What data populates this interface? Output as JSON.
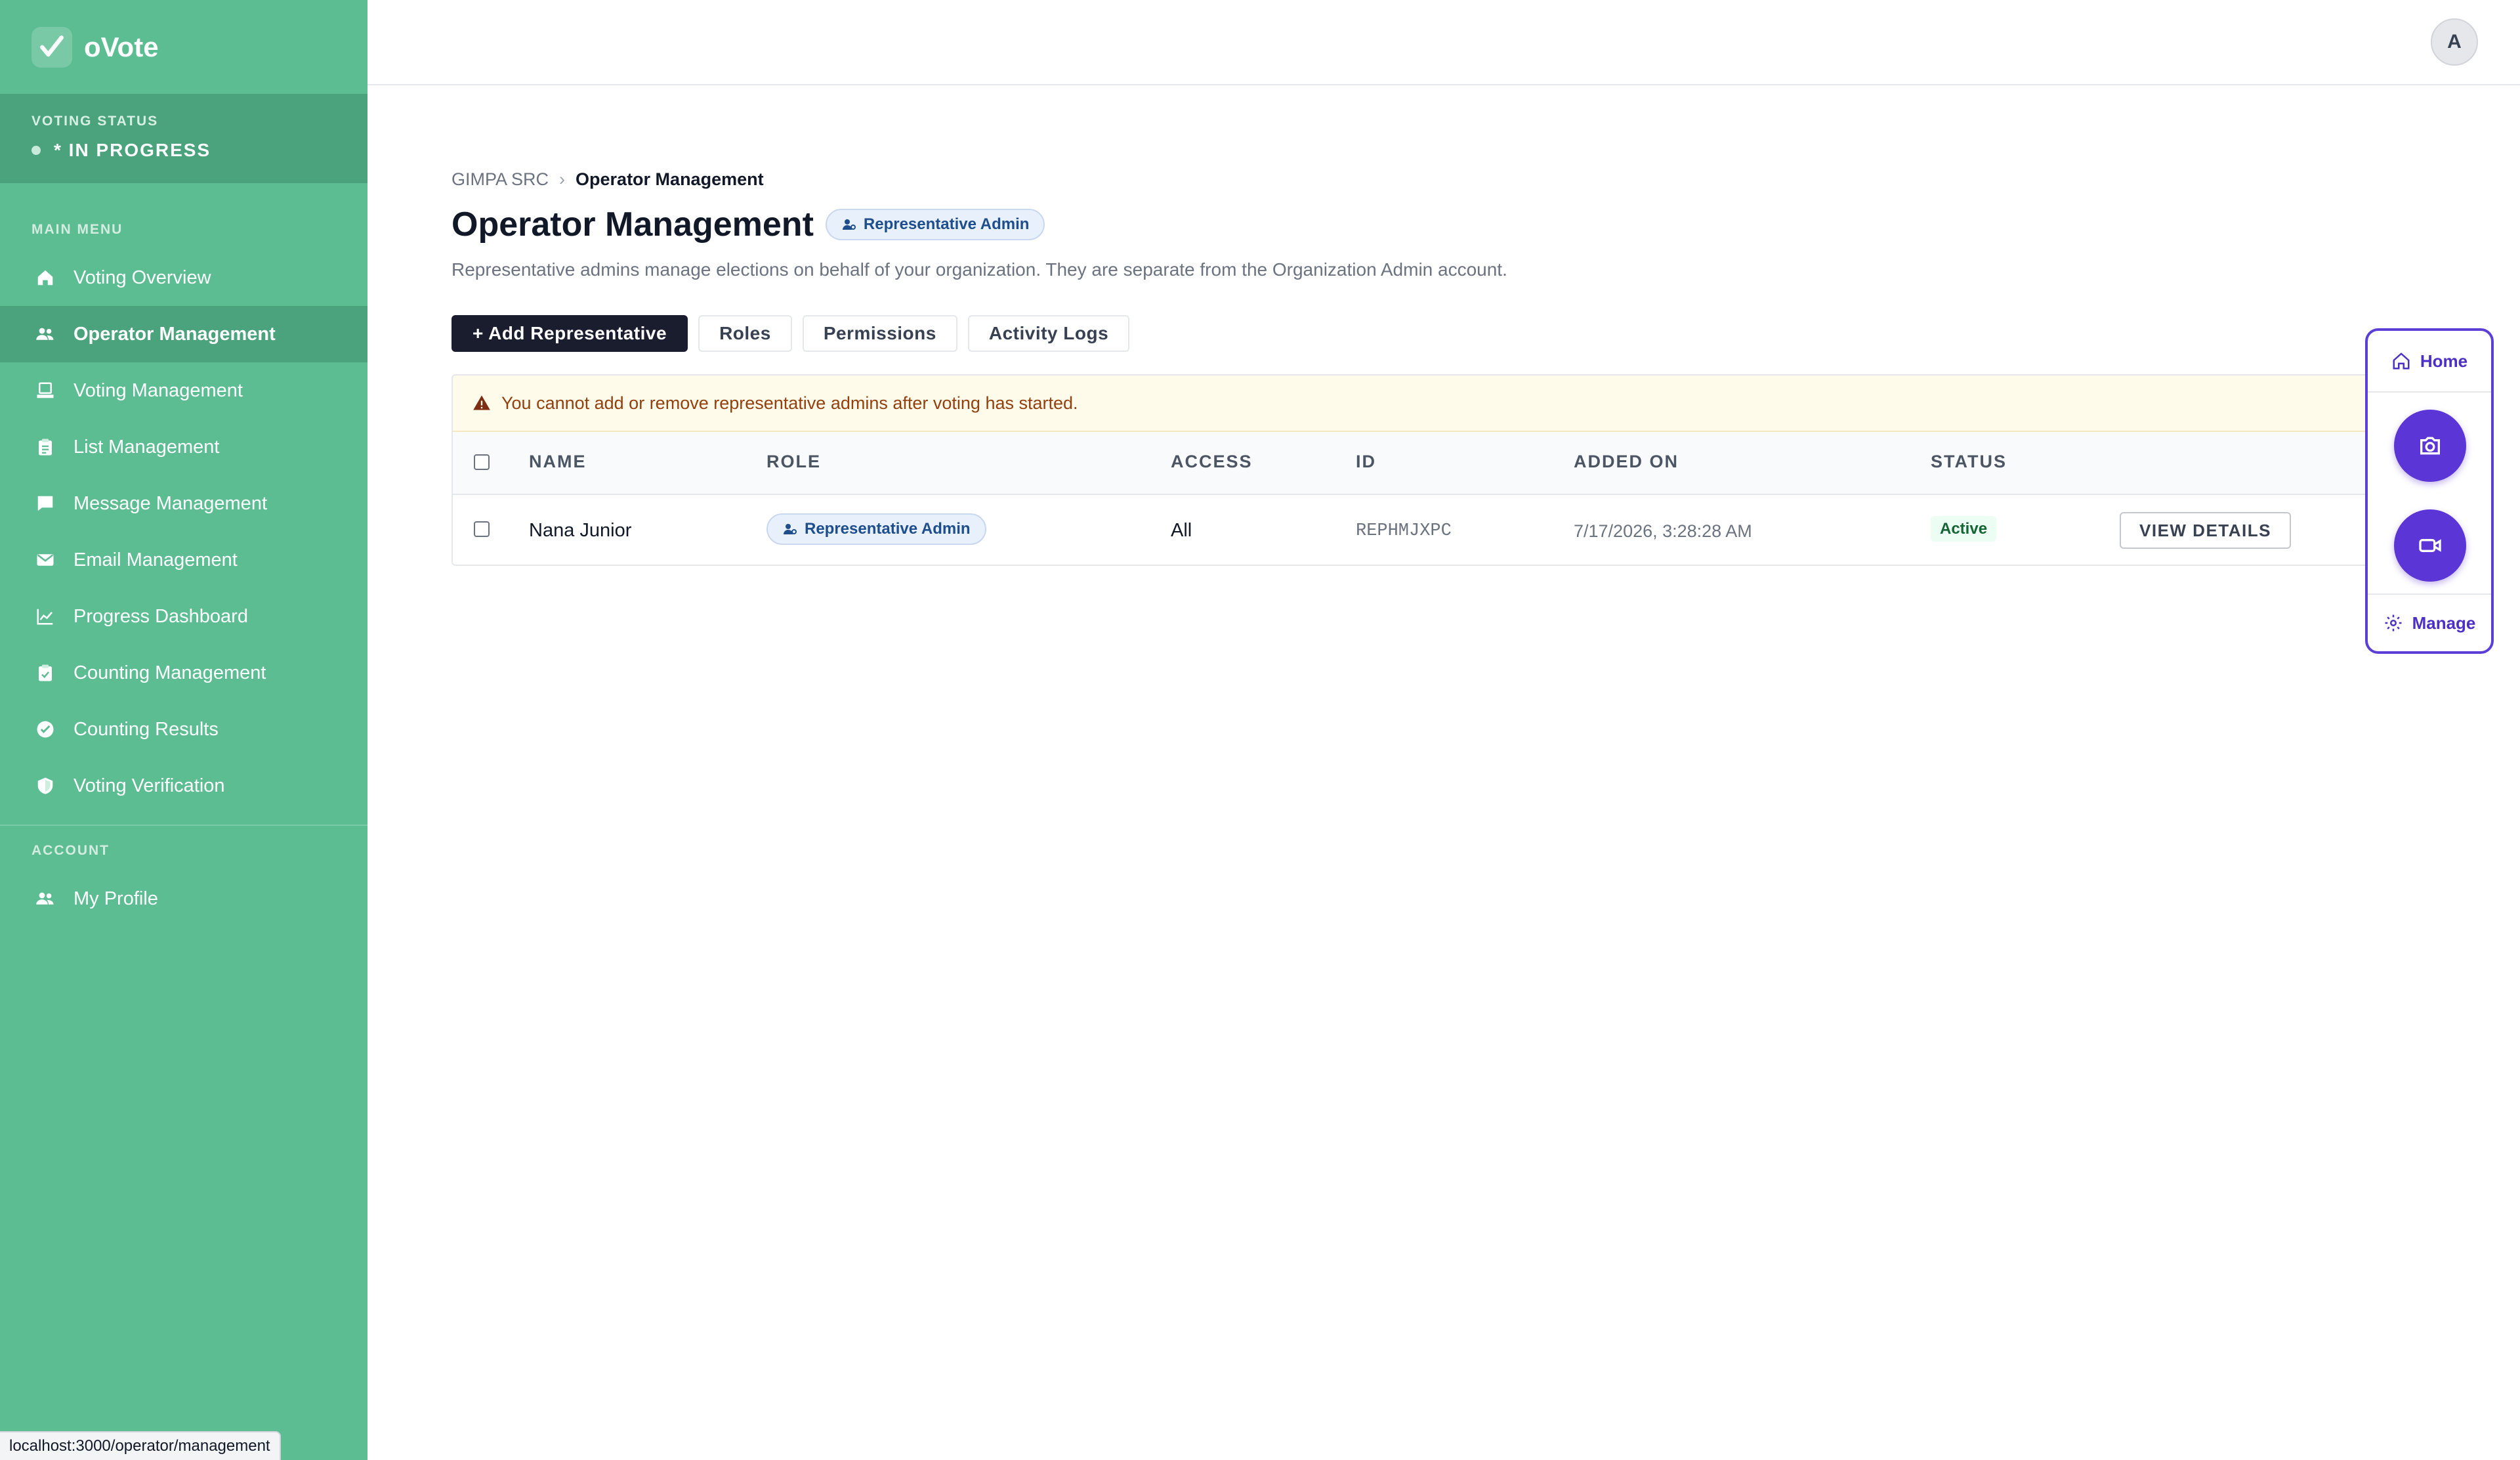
{
  "app": {
    "name": "oVote"
  },
  "voting_status": {
    "label": "VOTING STATUS",
    "value": "* IN PROGRESS"
  },
  "sidebar": {
    "main_menu_label": "MAIN MENU",
    "account_label": "ACCOUNT",
    "items": [
      {
        "label": "Voting Overview",
        "icon": "home-icon"
      },
      {
        "label": "Operator Management",
        "icon": "users-icon",
        "active": true
      },
      {
        "label": "Voting Management",
        "icon": "ballot-icon"
      },
      {
        "label": "List Management",
        "icon": "clipboard-icon"
      },
      {
        "label": "Message Management",
        "icon": "chat-icon"
      },
      {
        "label": "Email Management",
        "icon": "mail-icon"
      },
      {
        "label": "Progress Dashboard",
        "icon": "chart-icon"
      },
      {
        "label": "Counting Management",
        "icon": "clipboard-check-icon"
      },
      {
        "label": "Counting Results",
        "icon": "check-circle-icon"
      },
      {
        "label": "Voting Verification",
        "icon": "shield-icon"
      }
    ],
    "account_items": [
      {
        "label": "My Profile",
        "icon": "users-icon"
      }
    ]
  },
  "topbar": {
    "avatar_initial": "A"
  },
  "breadcrumb": {
    "root": "GIMPA SRC",
    "current": "Operator Management"
  },
  "header": {
    "title": "Operator Management",
    "badge": "Representative Admin",
    "subtitle": "Representative admins manage elections on behalf of your organization. They are separate from the Organization Admin account."
  },
  "actions": {
    "add": "+ Add Representative",
    "roles": "Roles",
    "permissions": "Permissions",
    "activity_logs": "Activity Logs"
  },
  "alert": {
    "text": "You cannot add or remove representative admins after voting has started."
  },
  "table": {
    "columns": [
      "NAME",
      "ROLE",
      "ACCESS",
      "ID",
      "ADDED ON",
      "STATUS"
    ],
    "rows": [
      {
        "name": "Nana Junior",
        "role": "Representative Admin",
        "access": "All",
        "id": "REPHMJXPC",
        "added_on": "7/17/2026, 3:28:28 AM",
        "status": "Active",
        "action": "VIEW DETAILS"
      }
    ]
  },
  "floating_panel": {
    "home": "Home",
    "manage": "Manage"
  },
  "status_bar": {
    "url": "localhost:3000/operator/management"
  },
  "colors": {
    "sidebar": "#5cbd93",
    "sidebar_active": "#4aa37c",
    "primary_button": "#1a1d2e",
    "accent_purple": "#5b35d5"
  }
}
